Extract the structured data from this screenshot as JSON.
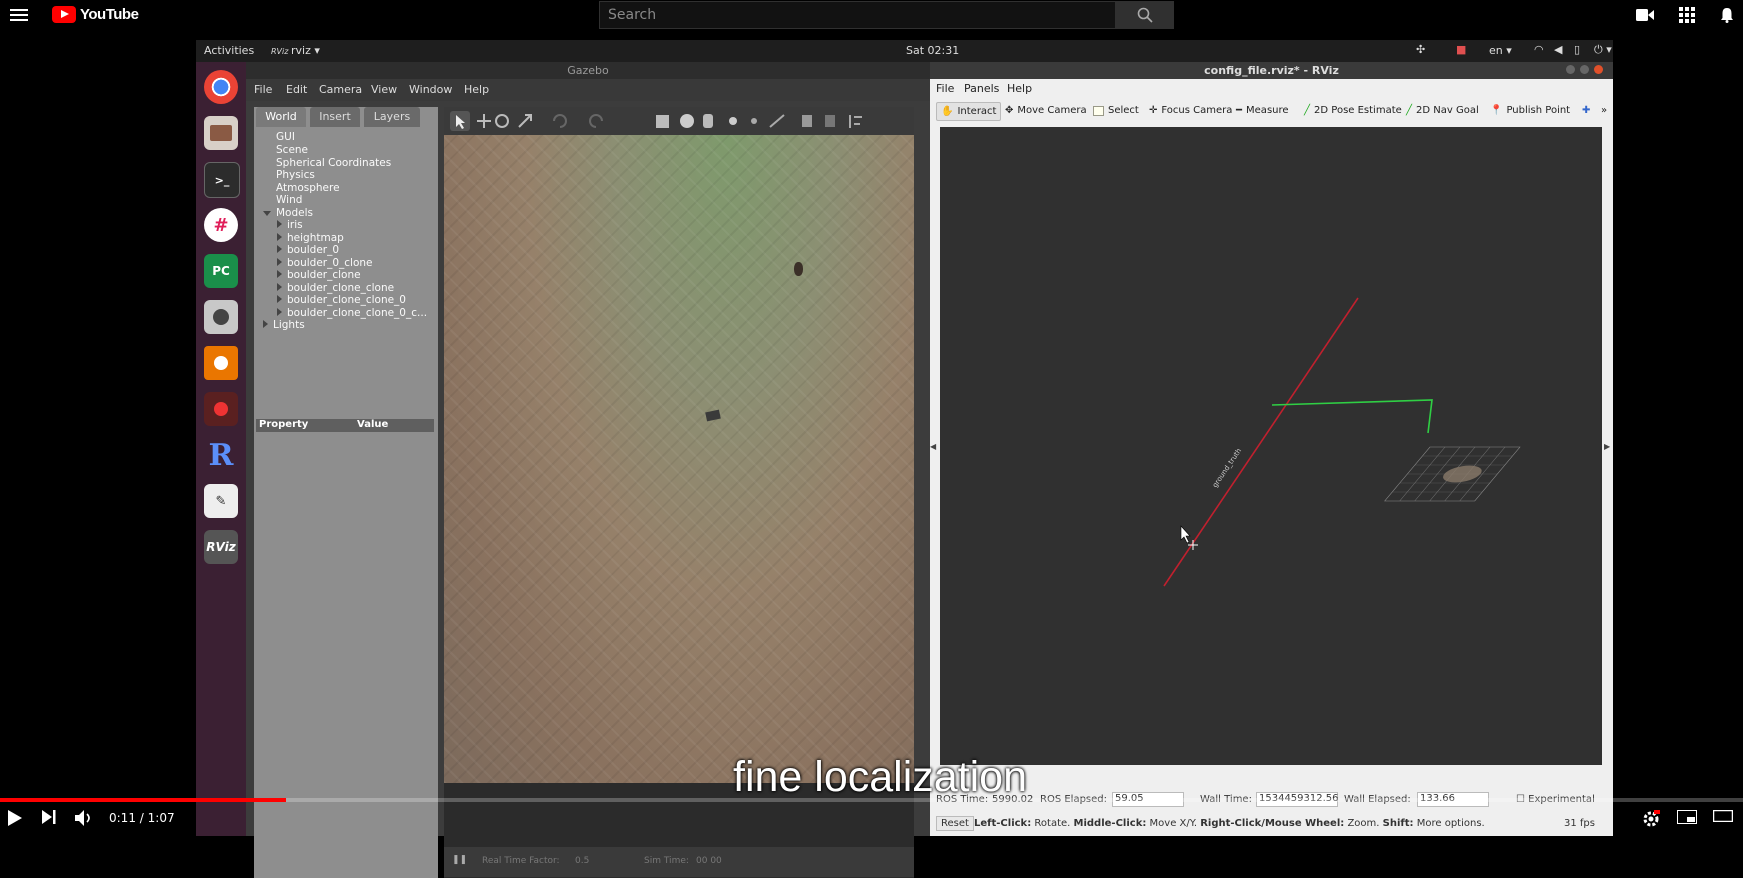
{
  "youtube": {
    "logo_text": "YouTube",
    "search_placeholder": "Search",
    "time_current": "0:11",
    "time_separator": "/",
    "time_total": "1:07",
    "progress_fraction": 0.164,
    "caption": "fine localization"
  },
  "ubuntu": {
    "activities": "Activities",
    "app_menu": "rviz",
    "clock": "Sat 02:31",
    "lang": "en"
  },
  "gazebo": {
    "title": "Gazebo",
    "menu": [
      "File",
      "Edit",
      "Camera",
      "View",
      "Window",
      "Help"
    ],
    "tabs": [
      "World",
      "Insert",
      "Layers"
    ],
    "tree": [
      "GUI",
      "Scene",
      "Spherical Coordinates",
      "Physics",
      "Atmosphere",
      "Wind",
      "Models"
    ],
    "models": [
      "iris",
      "heightmap",
      "boulder_0",
      "boulder_0_clone",
      "boulder_clone",
      "boulder_clone_clone",
      "boulder_clone_clone_0",
      "boulder_clone_clone_0_c..."
    ],
    "lights": "Lights",
    "prop_header": "Property",
    "value_header": "Value",
    "status_rtf_label": "Real Time Factor:",
    "status_rtf_value": "0.5",
    "status_sim_label": "Sim Time:",
    "status_sim_value": "00 00"
  },
  "rviz": {
    "title": "config_file.rviz* - RViz",
    "menu": [
      "File",
      "Panels",
      "Help"
    ],
    "tools": [
      "Interact",
      "Move Camera",
      "Select",
      "Focus Camera",
      "Measure",
      "2D Pose Estimate",
      "2D Nav Goal",
      "Publish Point"
    ],
    "frame_label": "ground_truth",
    "ros_time_label": "ROS Time:",
    "ros_time_value": "5990.02",
    "ros_elapsed_label": "ROS Elapsed:",
    "ros_elapsed_value": "59.05",
    "wall_time_label": "Wall Time:",
    "wall_time_value": "1534459312.56",
    "wall_elapsed_label": "Wall Elapsed:",
    "wall_elapsed_value": "133.66",
    "experimental_label": "Experimental",
    "reset_label": "Reset",
    "hint_left": "Left-Click:",
    "hint_left_text": "Rotate.",
    "hint_middle": "Middle-Click:",
    "hint_middle_text": "Move X/Y.",
    "hint_right": "Right-Click/Mouse Wheel:",
    "hint_right_text": "Zoom.",
    "hint_shift": "Shift:",
    "hint_shift_text": "More options.",
    "fps": "31 fps"
  },
  "dock_icons": [
    "chrome-icon",
    "files-icon",
    "terminal-icon",
    "slack-icon",
    "pycharm-icon",
    "camera-icon",
    "blender-icon",
    "recorder-icon",
    "r-icon",
    "editor-icon",
    "rviz-icon"
  ],
  "colors": {
    "youtube_red": "#ff0000",
    "dock_bg": "#3b2033",
    "rviz_bg": "#303030"
  }
}
